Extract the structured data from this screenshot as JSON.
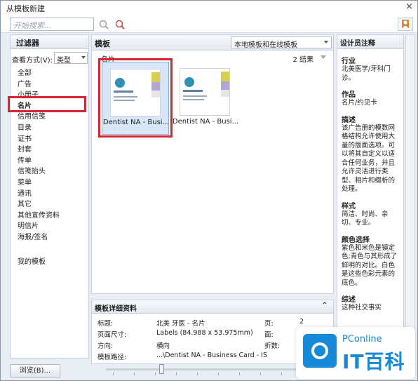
{
  "window": {
    "title": "从模板新建",
    "close": "×"
  },
  "search": {
    "placeholder": "开始搜索..."
  },
  "left": {
    "header": "过滤器",
    "view_label": "查看方式(V):",
    "view_value": "类型",
    "categories": [
      "全部",
      "广告",
      "小册子",
      "名片",
      "信用信笺",
      "目录",
      "证书",
      "封套",
      "传单",
      "信笺抬头",
      "菜单",
      "通讯",
      "其它",
      "其他宣传资料",
      "明信片",
      "海报/签名"
    ],
    "selected_category": "名片",
    "my_templates": "我的模板",
    "browse": "浏览(B)..."
  },
  "center": {
    "header": "模板",
    "source": "本地模板和在线模板",
    "group": "名片",
    "count": "2 结果",
    "templates": [
      {
        "caption": "Dentist NA - Busi..."
      },
      {
        "caption": "Dentist NA - Busi..."
      }
    ]
  },
  "details": {
    "header": "模板详细资料",
    "collapse": "⌃",
    "rows": [
      {
        "label": "标题:",
        "value": "北美 牙医 - 名片",
        "label2": "页:",
        "value2": "2"
      },
      {
        "label": "页面尺寸:",
        "value": "Labels (84.988 x 53.975mm)",
        "label2": "面:",
        "value2": ""
      },
      {
        "label": "方向:",
        "value": "横向",
        "label2": "折数:",
        "value2": ""
      },
      {
        "label": "模板路径:",
        "value": "...\\Dentist NA - Business Card - IS",
        "label2": "",
        "value2": ""
      }
    ]
  },
  "right": {
    "header": "设计员注释",
    "industry_h": "行业",
    "industry": "北美医学/牙科门诊。",
    "work_h": "作品",
    "work": "名片/约见卡",
    "desc_h": "描述",
    "desc": "该广告册的模数网格结构允许使用大量的版面选项。可以将其自定义以适合任何业务，并且允许灵活进行类型、相片和缀析的处理。",
    "style_h": "样式",
    "style": "简洁、时尚、亲切、专业。",
    "color_h": "颜色选择",
    "color": "紫色和米色是镇定色;青色与其形成了鲜明的对比。白色是这些色彩元素的底色。",
    "summary_h": "综述",
    "summary": "这种社交事实"
  },
  "watermark": {
    "top": "PConline",
    "main": "IT百科"
  },
  "colors": {
    "highlight": "#d7252f",
    "brand": "#1689d8"
  }
}
